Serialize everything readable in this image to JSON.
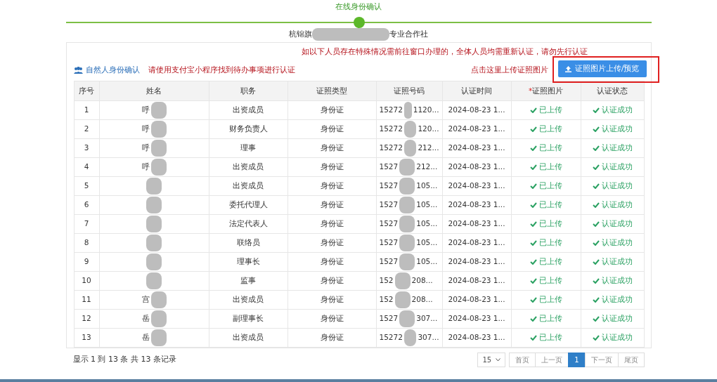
{
  "step": {
    "title": "在线身份确认",
    "active": true
  },
  "company": {
    "prefix": "杭锦旗",
    "suffix": "专业合作社",
    "redacted": true
  },
  "notice": "如以下人员存在特殊情况需前往窗口办理的，全体人员均需重新认证，请勿先行认证",
  "section": {
    "title": "自然人身份确认",
    "hint": "请使用支付宝小程序找到待办事项进行认证"
  },
  "upload": {
    "hint": "点击这里上传证照图片",
    "button": "证照图片上传/预览",
    "highlighted": true
  },
  "table": {
    "columns": [
      {
        "label": "序号"
      },
      {
        "label": "姓名"
      },
      {
        "label": "职务"
      },
      {
        "label": "证照类型"
      },
      {
        "label": "证照号码"
      },
      {
        "label": "认证时间"
      },
      {
        "label": "证照图片",
        "mark": "*"
      },
      {
        "label": "认证状态"
      }
    ],
    "rows": [
      {
        "no": "1",
        "name": "呼",
        "role": "出资成员",
        "id_type": "身份证",
        "id_start": "15272",
        "id_end": "1120...",
        "time": "2024-08-23 1...",
        "photo": "已上传",
        "status": "认证成功"
      },
      {
        "no": "2",
        "name": "呼",
        "role": "财务负责人",
        "id_type": "身份证",
        "id_start": "15272",
        "id_end": "120...",
        "time": "2024-08-23 1...",
        "photo": "已上传",
        "status": "认证成功"
      },
      {
        "no": "3",
        "name": "呼",
        "role": "理事",
        "id_type": "身份证",
        "id_start": "15272",
        "id_end": "212...",
        "time": "2024-08-23 1...",
        "photo": "已上传",
        "status": "认证成功"
      },
      {
        "no": "4",
        "name": "呼",
        "role": "出资成员",
        "id_type": "身份证",
        "id_start": "1527",
        "id_end": "212...",
        "time": "2024-08-23 1...",
        "photo": "已上传",
        "status": "认证成功"
      },
      {
        "no": "5",
        "role": "出资成员",
        "id_type": "身份证",
        "id_start": "1527",
        "id_end": "105...",
        "time": "2024-08-23 1...",
        "photo": "已上传",
        "status": "认证成功"
      },
      {
        "no": "6",
        "role": "委托代理人",
        "id_type": "身份证",
        "id_start": "1527",
        "id_end": "105...",
        "time": "2024-08-23 1...",
        "photo": "已上传",
        "status": "认证成功"
      },
      {
        "no": "7",
        "role": "法定代表人",
        "id_type": "身份证",
        "id_start": "1527",
        "id_end": "105...",
        "time": "2024-08-23 1...",
        "photo": "已上传",
        "status": "认证成功"
      },
      {
        "no": "8",
        "role": "联络员",
        "id_type": "身份证",
        "id_start": "1527",
        "id_end": "105...",
        "time": "2024-08-23 1...",
        "photo": "已上传",
        "status": "认证成功"
      },
      {
        "no": "9",
        "role": "理事长",
        "id_type": "身份证",
        "id_start": "1527",
        "id_end": "105...",
        "time": "2024-08-23 1...",
        "photo": "已上传",
        "status": "认证成功"
      },
      {
        "no": "10",
        "role": "监事",
        "id_type": "身份证",
        "id_start": "152",
        "id_end": "208...",
        "time": "2024-08-23 1...",
        "photo": "已上传",
        "status": "认证成功"
      },
      {
        "no": "11",
        "name": "宫",
        "role": "出资成员",
        "id_type": "身份证",
        "id_start": "152",
        "id_end": "208...",
        "time": "2024-08-23 1...",
        "photo": "已上传",
        "status": "认证成功"
      },
      {
        "no": "12",
        "name": "岳",
        "role": "副理事长",
        "id_type": "身份证",
        "id_start": "1527",
        "id_end": "307...",
        "time": "2024-08-23 1...",
        "photo": "已上传",
        "status": "认证成功"
      },
      {
        "no": "13",
        "name": "岳",
        "role": "出资成员",
        "id_type": "身份证",
        "id_start": "15272",
        "id_end": "307...",
        "time": "2024-08-23 1...",
        "photo": "已上传",
        "status": "认证成功"
      }
    ]
  },
  "footer": {
    "summary": "显示 1 到 13 条 共 13 条记录",
    "page_size": "15",
    "pages": [
      {
        "label": "首页",
        "selected": false
      },
      {
        "label": "上一页",
        "selected": false
      },
      {
        "label": "1",
        "selected": true
      },
      {
        "label": "下一页",
        "selected": false
      },
      {
        "label": "尾页",
        "selected": false
      }
    ]
  }
}
